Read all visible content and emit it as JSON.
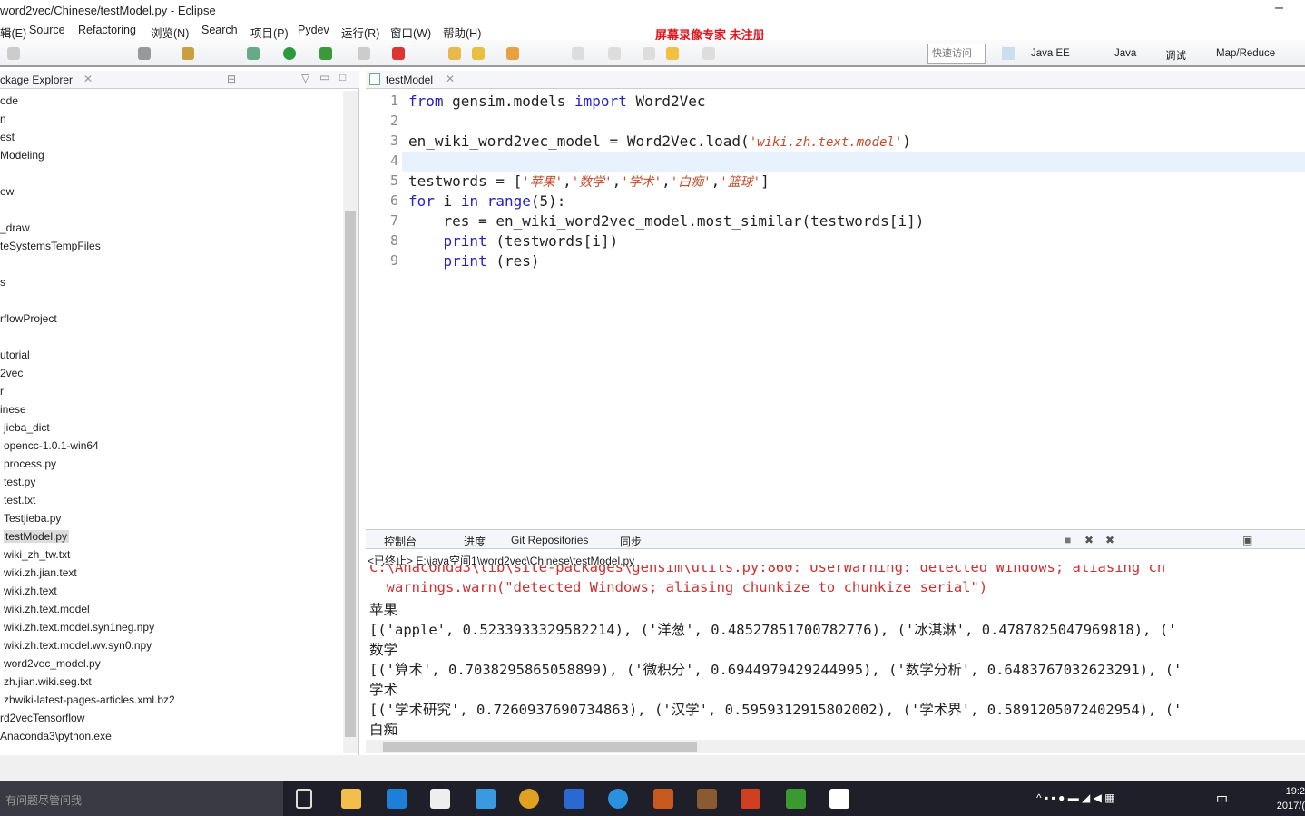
{
  "window": {
    "title": "word2vec/Chinese/testModel.py  -  Eclipse",
    "minimize": "–"
  },
  "watermark": "屏幕录像专家  未注册",
  "menu": [
    "辑(E)",
    "Source",
    "Refactoring",
    "浏览(N)",
    "Search",
    "项目(P)",
    "Pydev",
    "运行(R)",
    "窗口(W)",
    "帮助(H)"
  ],
  "toolbar": {
    "quick_access_placeholder": "快速访问",
    "perspectives": [
      "Java EE",
      "Java",
      "调试",
      "Map/Reduce"
    ],
    "ime": "中"
  },
  "explorer": {
    "title": "ckage Explorer",
    "items": [
      "ode",
      "n",
      "est",
      "Modeling",
      "",
      "ew",
      "",
      "_draw",
      "teSystemsTempFiles",
      "",
      "s",
      "",
      "rflowProject",
      "",
      "utorial",
      "2vec",
      "r",
      "inese",
      "jieba_dict",
      "opencc-1.0.1-win64",
      "process.py",
      "test.py",
      "test.txt",
      "Testjieba.py",
      "testModel.py",
      "wiki_zh_tw.txt",
      "wiki.zh.jian.text",
      "wiki.zh.text",
      "wiki.zh.text.model",
      "wiki.zh.text.model.syn1neg.npy",
      "wiki.zh.text.model.wv.syn0.npy",
      "word2vec_model.py",
      "zh.jian.wiki.seg.txt",
      "zhwiki-latest-pages-articles.xml.bz2",
      "rd2vecTensorflow",
      "Anaconda3\\python.exe"
    ],
    "selected": "testModel.py"
  },
  "editor": {
    "tab": "testModel",
    "lines": [
      [
        {
          "t": "from",
          "c": "kw"
        },
        {
          "t": " gensim.models "
        },
        {
          "t": "import",
          "c": "kw"
        },
        {
          "t": " Word2Vec"
        }
      ],
      [],
      [
        {
          "t": "en_wiki_word2vec_model = Word2Vec.load("
        },
        {
          "t": "'wiki.zh.text.model'",
          "c": "str"
        },
        {
          "t": ")"
        }
      ],
      [],
      [
        {
          "t": "testwords = ["
        },
        {
          "t": "'苹果'",
          "c": "str"
        },
        {
          "t": ","
        },
        {
          "t": "'数学'",
          "c": "str"
        },
        {
          "t": ","
        },
        {
          "t": "'学术'",
          "c": "str"
        },
        {
          "t": ","
        },
        {
          "t": "'白痴'",
          "c": "str"
        },
        {
          "t": ","
        },
        {
          "t": "'篮球'",
          "c": "str"
        },
        {
          "t": "]"
        }
      ],
      [
        {
          "t": "for",
          "c": "kw"
        },
        {
          "t": " i "
        },
        {
          "t": "in",
          "c": "kw"
        },
        {
          "t": " "
        },
        {
          "t": "range",
          "c": "kw"
        },
        {
          "t": "(5):"
        }
      ],
      [
        {
          "t": "    res = en_wiki_word2vec_model.most_similar(testwords[i])"
        }
      ],
      [
        {
          "t": "    "
        },
        {
          "t": "print",
          "c": "kw"
        },
        {
          "t": " (testwords[i])"
        }
      ],
      [
        {
          "t": "    "
        },
        {
          "t": "print",
          "c": "kw"
        },
        {
          "t": " (res)"
        }
      ]
    ]
  },
  "console": {
    "tabs": [
      "控制台",
      "进度",
      "Git Repositories",
      "同步"
    ],
    "path": "<已终止> E:\\java空间1\\word2vec\\Chinese\\testModel.py",
    "lines": [
      {
        "t": "C:\\Anaconda3\\lib\\site-packages\\gensim\\utils.py:860: UserWarning: detected Windows; aliasing ch",
        "c": "err"
      },
      {
        "t": "  warnings.warn(\"detected Windows; aliasing chunkize to chunkize_serial\")",
        "c": "err"
      },
      {
        "t": "苹果"
      },
      {
        "t": "[('apple', 0.5233933329582214), ('洋葱', 0.48527851700782776), ('冰淇淋', 0.4787825047969818), ('"
      },
      {
        "t": "数学"
      },
      {
        "t": "[('算术', 0.7038295865058899), ('微积分', 0.6944979429244995), ('数学分析', 0.6483767032623291), ('"
      },
      {
        "t": "学术"
      },
      {
        "t": "[('学术研究', 0.7260937690734863), ('汉学', 0.5959312915802002), ('学术界', 0.5891205072402954), ('"
      },
      {
        "t": "白痴"
      }
    ]
  },
  "taskbar": {
    "search": "有问题尽管问我",
    "time": "19:2",
    "date": "2017/("
  }
}
